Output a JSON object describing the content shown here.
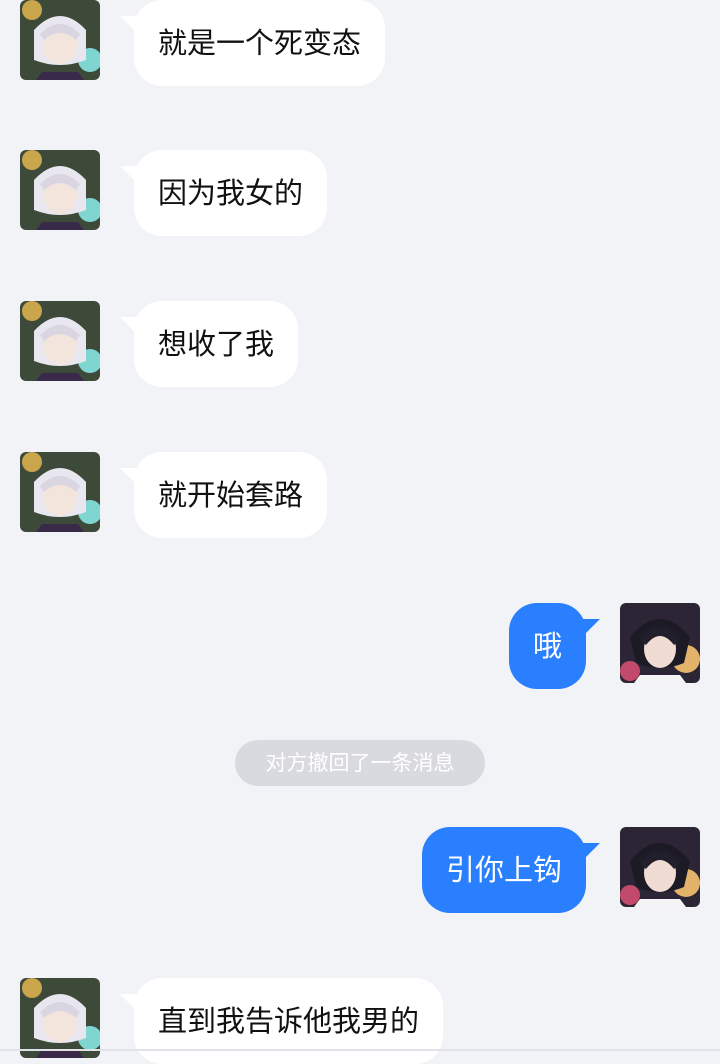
{
  "colors": {
    "background": "#f2f3f7",
    "incoming_bubble": "#ffffff",
    "outgoing_bubble": "#2a7fff",
    "system_pill": "#d9dadf"
  },
  "messages": [
    {
      "side": "in",
      "text": "就是一个死变态",
      "avatar": "anime-silver-hair-avatar"
    },
    {
      "side": "in",
      "text": "因为我女的",
      "avatar": "anime-silver-hair-avatar"
    },
    {
      "side": "in",
      "text": "想收了我",
      "avatar": "anime-silver-hair-avatar"
    },
    {
      "side": "in",
      "text": "就开始套路",
      "avatar": "anime-silver-hair-avatar"
    },
    {
      "side": "out",
      "text": "哦",
      "avatar": "anime-dark-hair-avatar"
    },
    {
      "side": "system",
      "text": "对方撤回了一条消息"
    },
    {
      "side": "out",
      "text": "引你上钩",
      "avatar": "anime-dark-hair-avatar"
    },
    {
      "side": "in",
      "text": "直到我告诉他我男的",
      "avatar": "anime-silver-hair-avatar"
    }
  ]
}
